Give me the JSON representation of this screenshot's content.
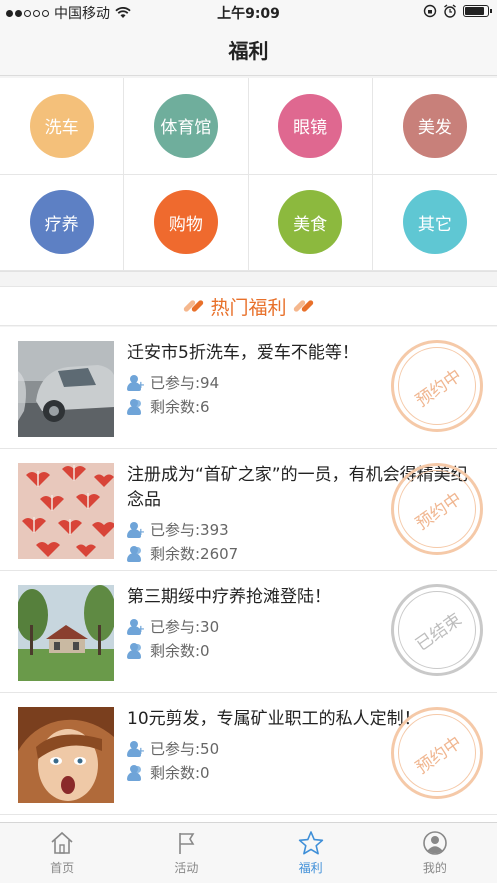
{
  "status_bar": {
    "carrier": "中国移动",
    "time": "上午9:09",
    "battery_level": 0.85
  },
  "nav": {
    "title": "福利"
  },
  "categories": [
    {
      "label": "洗车",
      "color": "#f4c07a"
    },
    {
      "label": "体育馆",
      "color": "#6fae9c"
    },
    {
      "label": "眼镜",
      "color": "#df6890"
    },
    {
      "label": "美发",
      "color": "#c8807a"
    },
    {
      "label": "疗养",
      "color": "#5d80c4"
    },
    {
      "label": "购物",
      "color": "#ef6a2e"
    },
    {
      "label": "美食",
      "color": "#8cb93e"
    },
    {
      "label": "其它",
      "color": "#5fc7d3"
    }
  ],
  "hot": {
    "title": "热门福利"
  },
  "items": [
    {
      "title": "迁安市5折洗车，爱车不能等！",
      "joined": "已参与:94",
      "remaining": "剩余数:6",
      "status": "预约中",
      "status_type": "active",
      "thumb": "car-wash-photo"
    },
    {
      "title": "注册成为“首矿之家”的一员，有机会得精美纪念品",
      "joined": "已参与:393",
      "remaining": "剩余数:2607",
      "status": "预约中",
      "status_type": "active",
      "thumb": "gift-boxes-photo"
    },
    {
      "title": "第三期绥中疗养抢滩登陆！",
      "joined": "已参与:30",
      "remaining": "剩余数:0",
      "status": "已结束",
      "status_type": "ended",
      "thumb": "resort-house-photo"
    },
    {
      "title": "10元剪发，专属矿业职工的私人定制！",
      "joined": "已参与:50",
      "remaining": "剩余数:0",
      "status": "预约中",
      "status_type": "active",
      "thumb": "haircut-woman-photo"
    }
  ],
  "tabs": [
    {
      "label": "首页",
      "icon": "home-icon",
      "active": false
    },
    {
      "label": "活动",
      "icon": "flag-icon",
      "active": false
    },
    {
      "label": "福利",
      "icon": "star-icon",
      "active": true
    },
    {
      "label": "我的",
      "icon": "user-icon",
      "active": false
    }
  ],
  "colors": {
    "accent": "#e8702a",
    "tab_active": "#3f8fd8"
  }
}
